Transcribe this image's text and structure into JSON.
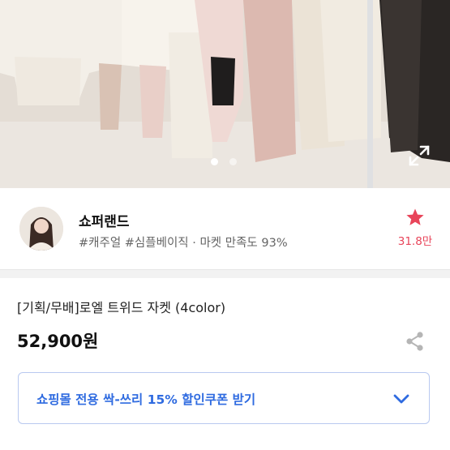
{
  "hero": {
    "slide_count": 2,
    "active_slide": 1
  },
  "seller": {
    "name": "쇼퍼랜드",
    "meta": "#캐주얼 #심플베이직 · 마켓 만족도 93%",
    "favorite_count": "31.8만"
  },
  "product": {
    "title": "[기획/무배]로엘 트위드 자켓 (4color)",
    "price": "52,900원"
  },
  "coupon": {
    "label": "쇼핑몰 전용 싹-쓰리 15% 할인쿠폰 받기"
  },
  "colors": {
    "accent_blue": "#2f6be0",
    "favorite_red": "#e8455a",
    "coupon_border": "#b9c9f0"
  },
  "icons": {
    "expand": "expand-icon",
    "star": "star-icon",
    "share": "share-icon",
    "chevron": "chevron-down-icon"
  }
}
